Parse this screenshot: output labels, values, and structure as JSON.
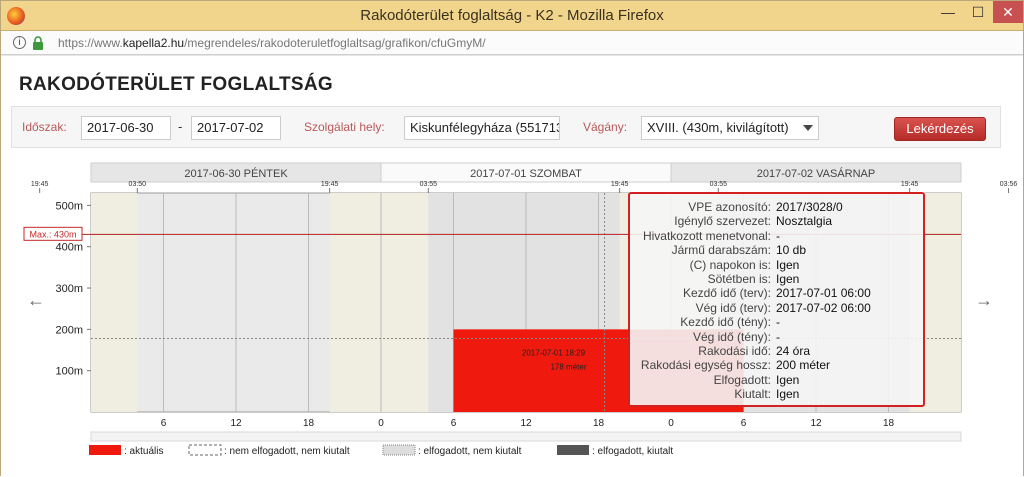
{
  "window": {
    "title": "Rakodóterület foglaltság - K2 - Mozilla Firefox",
    "min": "—",
    "max": "☐",
    "close": "✕"
  },
  "urlbar": {
    "url_prefix": "https://www.",
    "url_domain": "kapella2.hu",
    "url_path": "/megrendeles/rakodoteruletfoglaltsag/grafikon/cfuGmyM/",
    "info_icon": "i"
  },
  "page": {
    "title": "RAKODÓTERÜLET FOGLALTSÁG"
  },
  "filters": {
    "period_label": "Időszak:",
    "date_from": "2017-06-30",
    "dash": "-",
    "date_to": "2017-07-02",
    "place_label": "Szolgálati hely:",
    "place_value": "Kiskunfélegyháza (551713",
    "track_label": "Vágány:",
    "track_value": "XVIII. (430m, kivilágított)",
    "query_button": "Lekérdezés"
  },
  "nav": {
    "prev": "←",
    "next": "→"
  },
  "chart_data": {
    "type": "bar",
    "days": [
      {
        "label": "2017-06-30  PÉNTEK",
        "active": false
      },
      {
        "label": "2017-07-01  SZOMBAT",
        "active": true
      },
      {
        "label": "2017-07-02  VASÁRNAP",
        "active": false
      }
    ],
    "time_marks": [
      {
        "h": 19.75,
        "label": "19:45"
      },
      {
        "h": 27.833,
        "label": "03:50"
      },
      {
        "h": 43.75,
        "label": "19:45"
      },
      {
        "h": 51.917,
        "label": "03:55"
      },
      {
        "h": 67.75,
        "label": "19:45"
      },
      {
        "h": 75.917,
        "label": "03:55"
      },
      {
        "h": 91.75,
        "label": "19:45"
      },
      {
        "h": 99.933,
        "label": "03:56"
      }
    ],
    "hour_ticks": [
      {
        "h": 30,
        "label": "6"
      },
      {
        "h": 36,
        "label": "12"
      },
      {
        "h": 42,
        "label": "18"
      },
      {
        "h": 48,
        "label": "0"
      },
      {
        "h": 54,
        "label": "6"
      },
      {
        "h": 60,
        "label": "12"
      },
      {
        "h": 66,
        "label": "18"
      },
      {
        "h": 72,
        "label": "0"
      },
      {
        "h": 78,
        "label": "6"
      },
      {
        "h": 84,
        "label": "12"
      },
      {
        "h": 90,
        "label": "18"
      }
    ],
    "x_range_hours": [
      24,
      96
    ],
    "y_ticks": [
      {
        "v": 100,
        "label": "100m"
      },
      {
        "v": 200,
        "label": "200m"
      },
      {
        "v": 300,
        "label": "300m"
      },
      {
        "v": 400,
        "label": "400m"
      },
      {
        "v": 500,
        "label": "500m"
      }
    ],
    "ylim": [
      0,
      530
    ],
    "max_line": {
      "v": 430,
      "label": "Max.: 430m"
    },
    "dark_periods": [
      [
        24,
        27.833
      ],
      [
        43.75,
        51.917
      ],
      [
        67.75,
        75.917
      ],
      [
        91.75,
        96
      ]
    ],
    "bars": [
      {
        "start_h": 54,
        "end_h": 78,
        "length_m": 200,
        "assigned_m": 178,
        "start_label": "2017-07-01 18:29",
        "length_label": "178 méter",
        "color": "#f0190e"
      }
    ],
    "reference_line": {
      "h": 66.5,
      "v": 178
    },
    "legend": [
      {
        "label": ": aktuális",
        "style": "current"
      },
      {
        "label": ": nem elfogadott, nem kiutalt",
        "style": "dashed"
      },
      {
        "label": ": elfogadott, nem kiutalt",
        "style": "dotted"
      },
      {
        "label": ": elfogadott, kiutalt",
        "style": "dark"
      }
    ]
  },
  "tooltip": {
    "rows": [
      {
        "k": "VPE azonosító:",
        "v": "2017/3028/0"
      },
      {
        "k": "Igénylő szervezet:",
        "v": "Nosztalgia"
      },
      {
        "k": "Hivatkozott menetvonal:",
        "v": "-"
      },
      {
        "k": "Jármű darabszám:",
        "v": "10 db"
      },
      {
        "k": "(C) napokon is:",
        "v": "Igen"
      },
      {
        "k": "Sötétben is:",
        "v": "Igen"
      },
      {
        "k": "Kezdő idő (terv):",
        "v": "2017-07-01 06:00"
      },
      {
        "k": "Vég idő (terv):",
        "v": "2017-07-02 06:00"
      },
      {
        "k": "Kezdő idő (tény):",
        "v": "-"
      },
      {
        "k": "Vég idő (tény):",
        "v": "-"
      },
      {
        "k": "Rakodási idő:",
        "v": "24 óra"
      },
      {
        "k": "Rakodási egység hossz:",
        "v": "200 méter"
      },
      {
        "k": "Elfogadott:",
        "v": "Igen"
      },
      {
        "k": "Kiutalt:",
        "v": "Igen"
      }
    ]
  },
  "colors": {
    "accent": "#d32020",
    "bar": "#f0190e",
    "night": "#eeeee2",
    "weekend": "#e4e4e4"
  }
}
